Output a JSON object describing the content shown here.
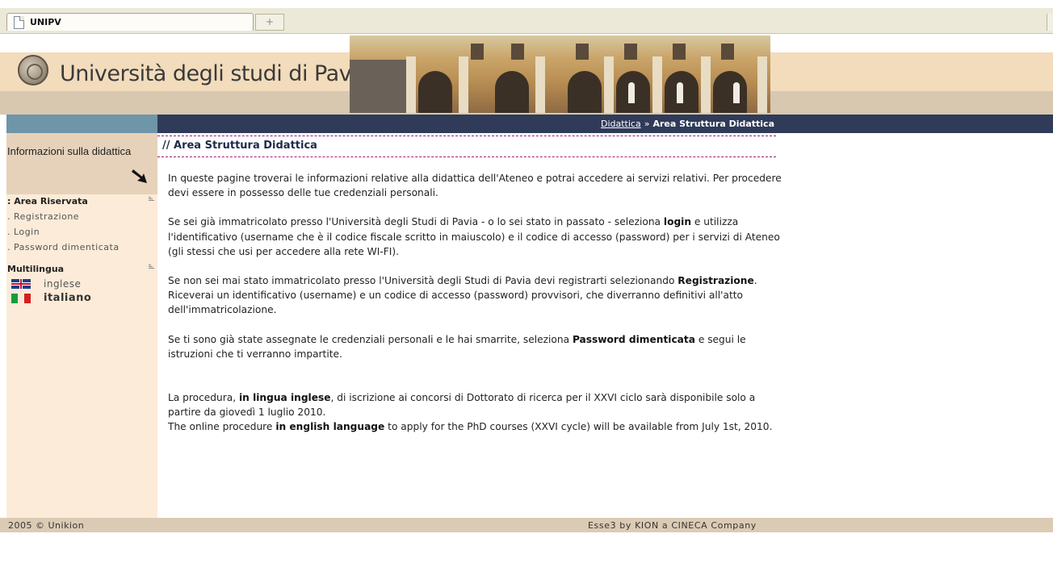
{
  "browser": {
    "tab_title": "UNIPV",
    "new_tab_symbol": "+"
  },
  "header": {
    "university_name": "Università degli studi di Pavia"
  },
  "breadcrumb": {
    "link": "Didattica",
    "separator": "»",
    "current": "Area Struttura Didattica"
  },
  "sidebar": {
    "title": "Informazioni sulla didattica",
    "sections": [
      {
        "heading": ": Area Riservata",
        "items": [
          ". Registrazione",
          ". Login",
          ". Password dimenticata"
        ]
      },
      {
        "heading": "Multilingua",
        "languages": [
          {
            "label": "inglese",
            "flag": "uk-flag",
            "active": false
          },
          {
            "label": "italiano",
            "flag": "italy-flag",
            "active": true
          }
        ]
      }
    ]
  },
  "main": {
    "title": "// Area Struttura Didattica",
    "paragraphs": [
      {
        "parts": [
          "In queste pagine troverai le informazioni relative alla didattica dell'Ateneo e potrai accedere ai servizi relativi. Per procedere devi essere in possesso delle tue credenziali personali."
        ]
      },
      {
        "parts": [
          "Se sei già immatricolato presso l'Università degli Studi di Pavia - o lo sei stato in passato - seleziona ",
          "login",
          " e utilizza l'identificativo (username che è il codice fiscale scritto in maiuscolo) e il codice di accesso (password) per i servizi di Ateneo (gli stessi che usi per accedere alla rete WI-FI)."
        ]
      },
      {
        "parts": [
          "Se non sei mai stato immatricolato presso l'Università degli Studi di Pavia devi registrarti selezionando ",
          "Registrazione",
          ". Riceverai un identificativo (username) e un codice di accesso (password) provvisori, che diverranno definitivi all'atto dell'immatricolazione."
        ]
      },
      {
        "parts": [
          "Se ti sono già state assegnate le credenziali personali e le hai smarrite, seleziona ",
          "Password dimenticata",
          " e segui le istruzioni che ti verranno impartite."
        ]
      }
    ],
    "notice": {
      "it_parts": [
        "La procedura, ",
        "in lingua inglese",
        ", di iscrizione ai concorsi di Dottorato di ricerca per il XXVI ciclo sarà disponibile solo a partire da giovedì 1 luglio 2010."
      ],
      "en_parts": [
        "The online procedure ",
        "in english language",
        " to apply for the PhD courses (XXVI cycle) will be available from July 1st, 2010."
      ]
    }
  },
  "footer": {
    "left": "2005 © Unikion",
    "right": "Esse3 by KION a CINECA Company"
  },
  "colors": {
    "nav_side": "#6f95a8",
    "nav_main": "#2f3b58",
    "sidebar_bg": "#fbebd8",
    "title_accent": "#a01a7a",
    "footer_bg": "#dccbb4"
  }
}
